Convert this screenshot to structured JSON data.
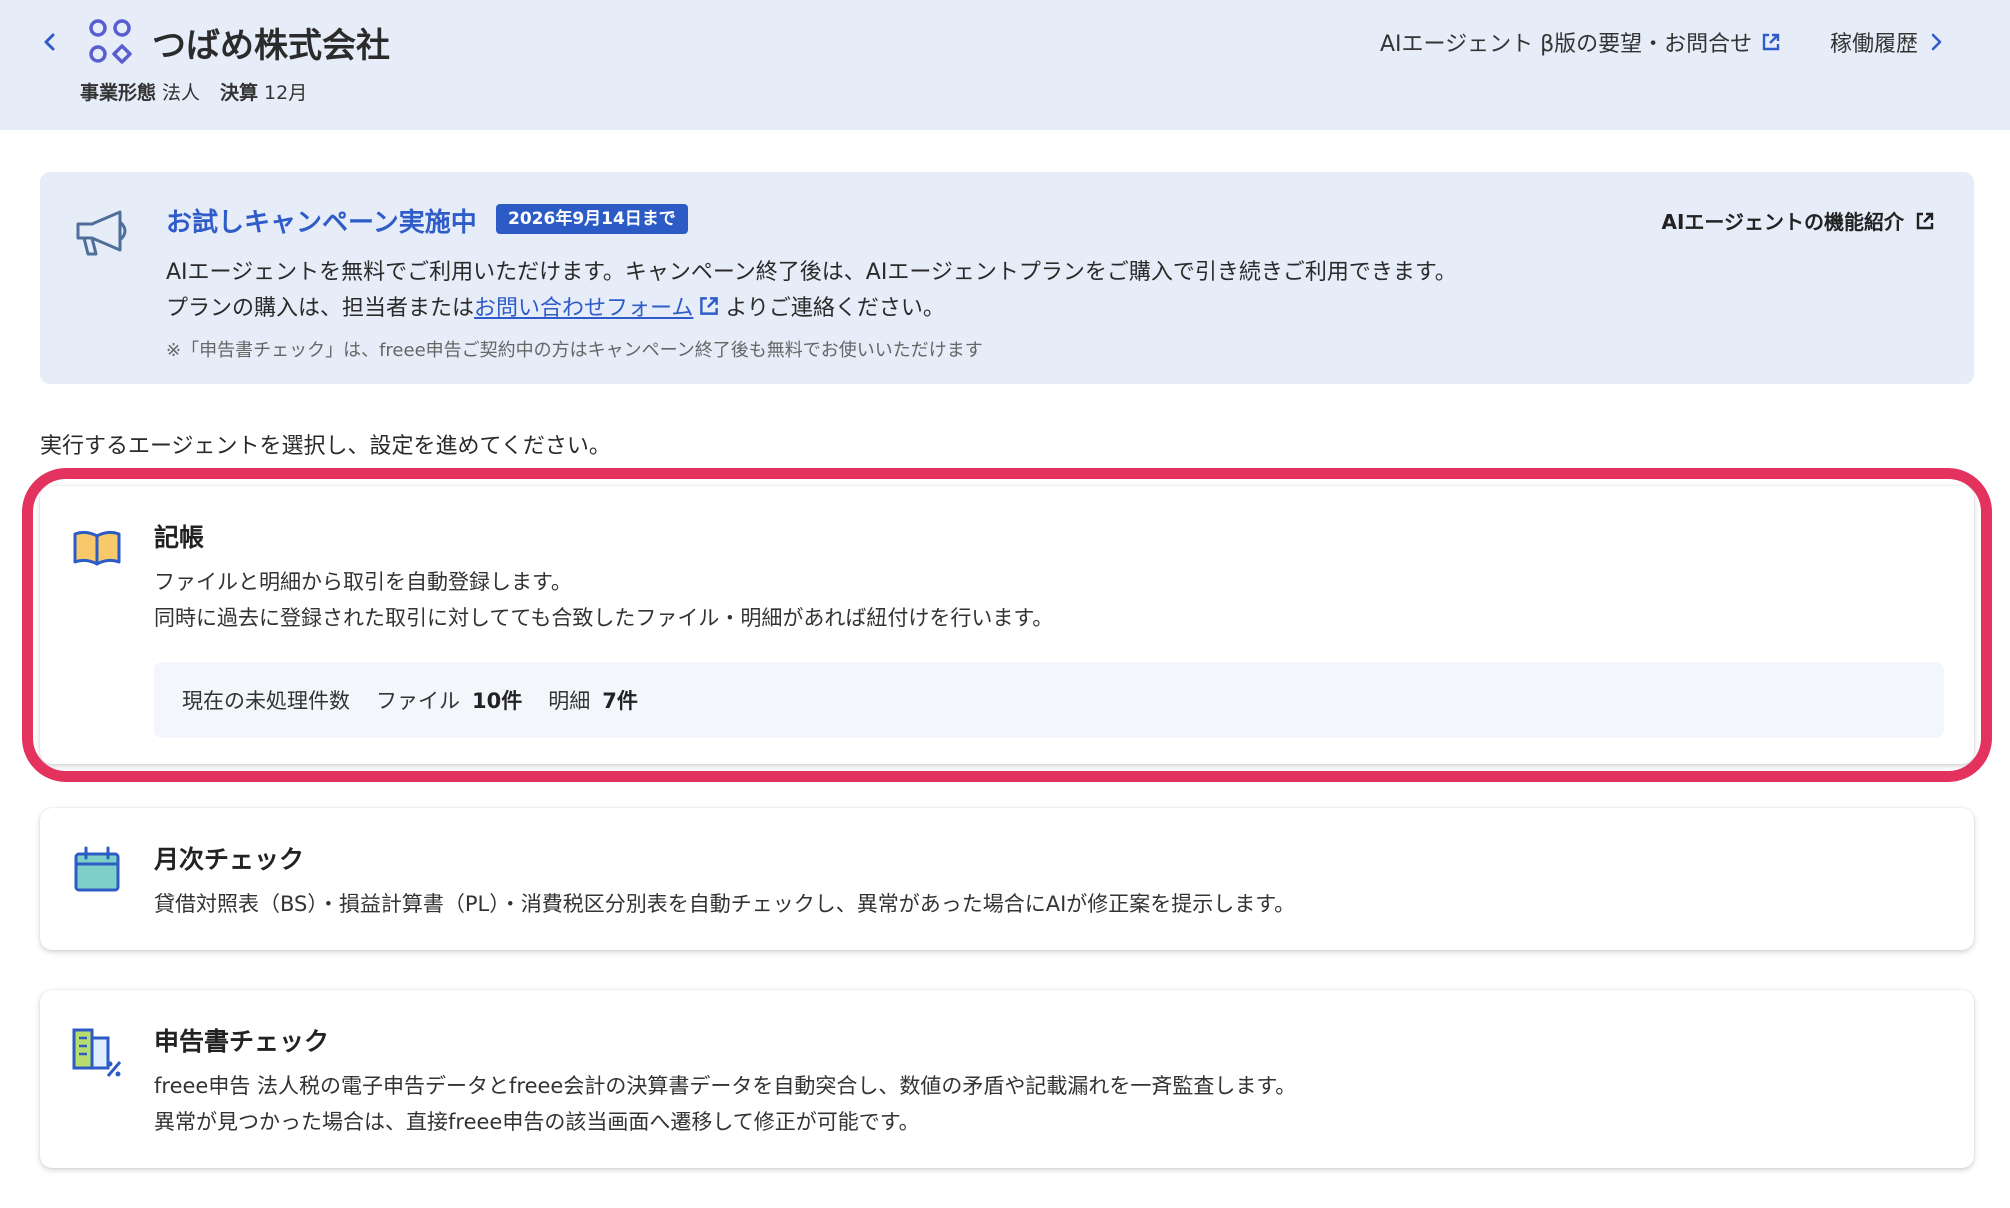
{
  "header": {
    "company_name": "つばめ株式会社",
    "business_type_label": "事業形態",
    "business_type_value": "法人",
    "fiscal_label": "決算",
    "fiscal_value": "12月",
    "feedback_link": "AIエージェント β版の要望・お問合せ",
    "history_link": "稼働履歴"
  },
  "banner": {
    "title": "お試しキャンペーン実施中",
    "badge": "2026年9月14日まで",
    "intro_link": "AIエージェントの機能紹介",
    "line1": "AIエージェントを無料でご利用いただけます。キャンペーン終了後は、AIエージェントプランをご購入で引き続きご利用できます。",
    "line2_prefix": "プランの購入は、担当者または",
    "line2_link": "お問い合わせフォーム",
    "line2_suffix": "よりご連絡ください。",
    "note": "※「申告書チェック」は、freee申告ご契約中の方はキャンペーン終了後も無料でお使いいただけます"
  },
  "instruction": "実行するエージェントを選択し、設定を進めてください。",
  "agents": [
    {
      "title": "記帳",
      "icon": "book-icon",
      "desc_lines": [
        "ファイルと明細から取引を自動登録します。",
        "同時に過去に登録された取引に対してても合致したファイル・明細があれば紐付けを行います。"
      ],
      "pending_label": "現在の未処理件数",
      "files_label": "ファイル",
      "files_count": "10件",
      "statements_label": "明細",
      "statements_count": "7件"
    },
    {
      "title": "月次チェック",
      "icon": "calendar-icon",
      "desc_lines": [
        "貸借対照表（BS）・損益計算書（PL）・消費税区分別表を自動チェックし、異常があった場合にAIが修正案を提示します。"
      ]
    },
    {
      "title": "申告書チェック",
      "icon": "tax-document-icon",
      "desc_lines": [
        "freee申告 法人税の電子申告データとfreee会計の決算書データを自動突合し、数値の矛盾や記載漏れを一斉監査します。",
        "異常が見つかった場合は、直接freee申告の該当画面へ遷移して修正が可能です。"
      ]
    }
  ],
  "colors": {
    "header_bg": "#e6edf9",
    "accent_blue": "#2f5cc8",
    "highlight_pink": "#e3325e"
  }
}
